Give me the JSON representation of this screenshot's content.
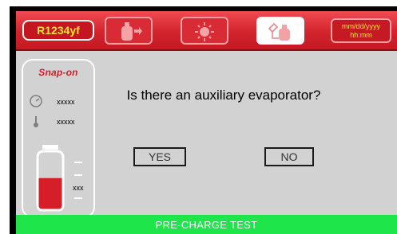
{
  "header": {
    "refrigerant": "R1234yf",
    "date_format": "mm/dd/yyyy",
    "time_format": "hh:mm",
    "modes": [
      {
        "icon": "recover-bottle-icon",
        "active": false
      },
      {
        "icon": "vacuum-pump-icon",
        "active": false
      },
      {
        "icon": "charge-bottle-icon",
        "active": true
      }
    ]
  },
  "status_panel": {
    "brand": "Snap-on",
    "pressure_value": "xxxxx",
    "temperature_value": "xxxxx",
    "tank_value": "xxx",
    "tank_fill_fraction": 0.55
  },
  "dialog": {
    "question": "Is there an auxiliary evaporator?",
    "yes_label": "YES",
    "no_label": "NO"
  },
  "footer": {
    "status": "PRE-CHARGE TEST"
  },
  "colors": {
    "header_red": "#d3232d",
    "accent_yellow": "#ffe033",
    "footer_green": "#1ee64a",
    "background_gray": "#d2d2d2"
  }
}
